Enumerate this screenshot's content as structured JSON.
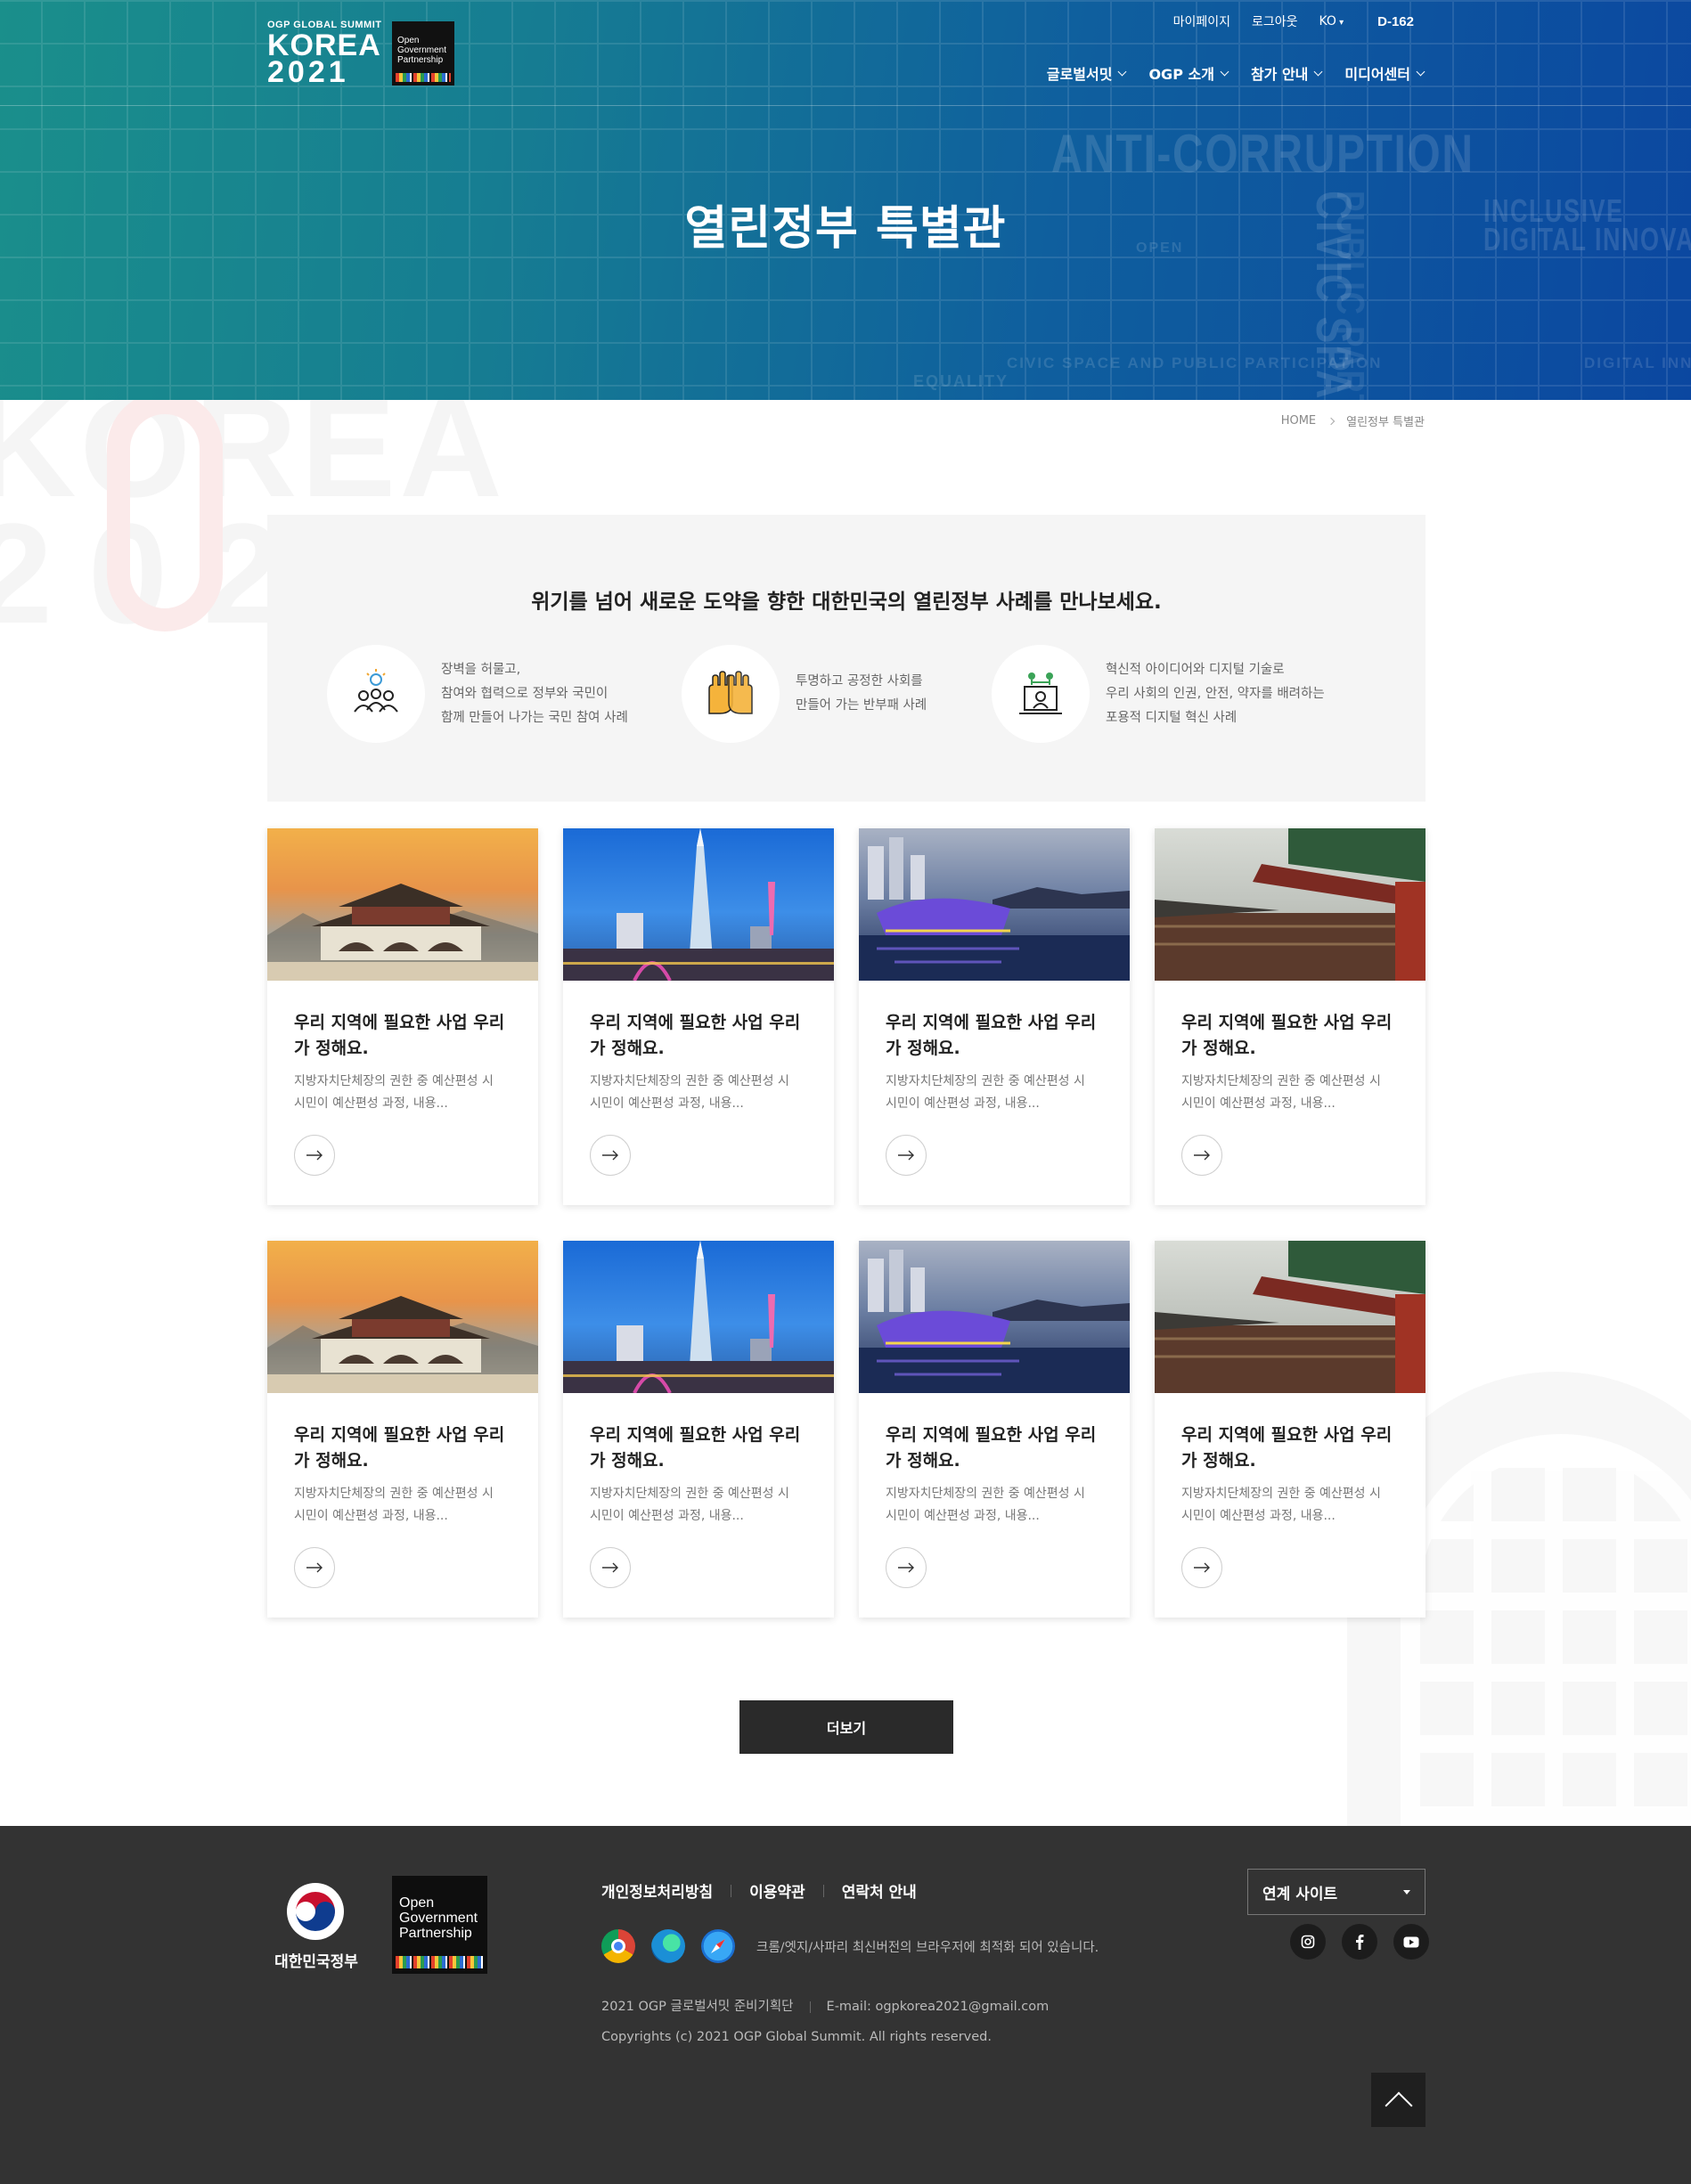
{
  "header": {
    "logo": {
      "summit": "OGP GLOBAL SUMMIT",
      "korea": "KOREA",
      "year": "2021",
      "ogp_lines": [
        "Open",
        "Government",
        "Partnership"
      ]
    },
    "util": {
      "mypage": "마이페이지",
      "logout": "로그아웃",
      "lang": "KO",
      "dday": "D-162"
    },
    "nav": [
      {
        "label": "글로벌서밋"
      },
      {
        "label": "OGP 소개"
      },
      {
        "label": "참가 안내"
      },
      {
        "label": "미디어센터"
      }
    ],
    "title": "열린정부 특별관",
    "background_words": [
      "ANTI-CORRUPTION",
      "CIVIC SPACE",
      "PUBLIC PARTICIPATION",
      "INCLUSIVE",
      "DIGITAL INNOVATIO",
      "OPEN",
      "EQUALITY",
      "CIVIC SPACE AND PUBLIC PARTICIPATION",
      "DIGITAL INNOV"
    ]
  },
  "breadcrumb": {
    "home": "HOME",
    "current": "열린정부 특별관"
  },
  "intro": {
    "title": "위기를 넘어 새로운 도약을 향한 대한민국의 열린정부 사례를 만나보세요.",
    "features": [
      {
        "icon": "people-idea-icon",
        "lines": [
          "장벽을 허물고,",
          "참여와 협력으로 정부와 국민이",
          "함께 만들어 나가는 국민 참여 사례"
        ]
      },
      {
        "icon": "clean-hands-icon",
        "lines": [
          "투명하고 공정한 사회를",
          "만들어 가는 반부패 사례"
        ]
      },
      {
        "icon": "digital-innovation-icon",
        "lines": [
          "혁신적 아이디어와 디지털 기술로",
          "우리 사회의 인권, 안전, 약자를 배려하는",
          "포용적 디지털 혁신 사례"
        ]
      }
    ]
  },
  "cards": [
    {
      "image": "gyeongbokgung-gate-sunset",
      "title": "우리 지역에 필요한 사업 우리가 정해요.",
      "desc": "지방자치단체장의 권한 중 예산편성 시 시민이 예산편성 과정, 내용..."
    },
    {
      "image": "lotte-tower-night",
      "title": "우리 지역에 필요한 사업 우리가 정해요.",
      "desc": "지방자치단체장의 권한 중 예산편성 시 시민이 예산편성 과정, 내용..."
    },
    {
      "image": "floating-island-river",
      "title": "우리 지역에 필요한 사업 우리가 정해요.",
      "desc": "지방자치단체장의 권한 중 예산편성 시 시민이 예산편성 과정, 내용..."
    },
    {
      "image": "palace-eaves",
      "title": "우리 지역에 필요한 사업 우리가 정해요.",
      "desc": "지방자치단체장의 권한 중 예산편성 시 시민이 예산편성 과정, 내용..."
    },
    {
      "image": "gyeongbokgung-gate-sunset",
      "title": "우리 지역에 필요한 사업 우리가 정해요.",
      "desc": "지방자치단체장의 권한 중 예산편성 시 시민이 예산편성 과정, 내용..."
    },
    {
      "image": "lotte-tower-night",
      "title": "우리 지역에 필요한 사업 우리가 정해요.",
      "desc": "지방자치단체장의 권한 중 예산편성 시 시민이 예산편성 과정, 내용..."
    },
    {
      "image": "floating-island-river",
      "title": "우리 지역에 필요한 사업 우리가 정해요.",
      "desc": "지방자치단체장의 권한 중 예산편성 시 시민이 예산편성 과정, 내용..."
    },
    {
      "image": "palace-eaves",
      "title": "우리 지역에 필요한 사업 우리가 정해요.",
      "desc": "지방자치단체장의 권한 중 예산편성 시 시민이 예산편성 과정, 내용..."
    }
  ],
  "more_button": "더보기",
  "footer": {
    "gov_name": "대한민국정부",
    "ogp_lines": [
      "Open",
      "Government",
      "Partnership"
    ],
    "links": [
      "개인정보처리방침",
      "이용약관",
      "연락처 안내"
    ],
    "browser_note": "크롬/엣지/사파리 최신버전의 브라우저에 최적화 되어 있습니다.",
    "org": "2021 OGP 글로벌서밋 준비기획단",
    "email": "E-mail: ogpkorea2021@gmail.com",
    "copyright": "Copyrights (c) 2021 OGP Global Summit. All rights reserved.",
    "family_site": "연계 사이트",
    "sns": [
      "instagram-icon",
      "facebook-icon",
      "youtube-icon"
    ]
  },
  "colors": {
    "hero_start": "#1a8f8b",
    "hero_end": "#0b47a0",
    "footer_bg": "#333333",
    "button_dark": "#2a2a2a"
  }
}
